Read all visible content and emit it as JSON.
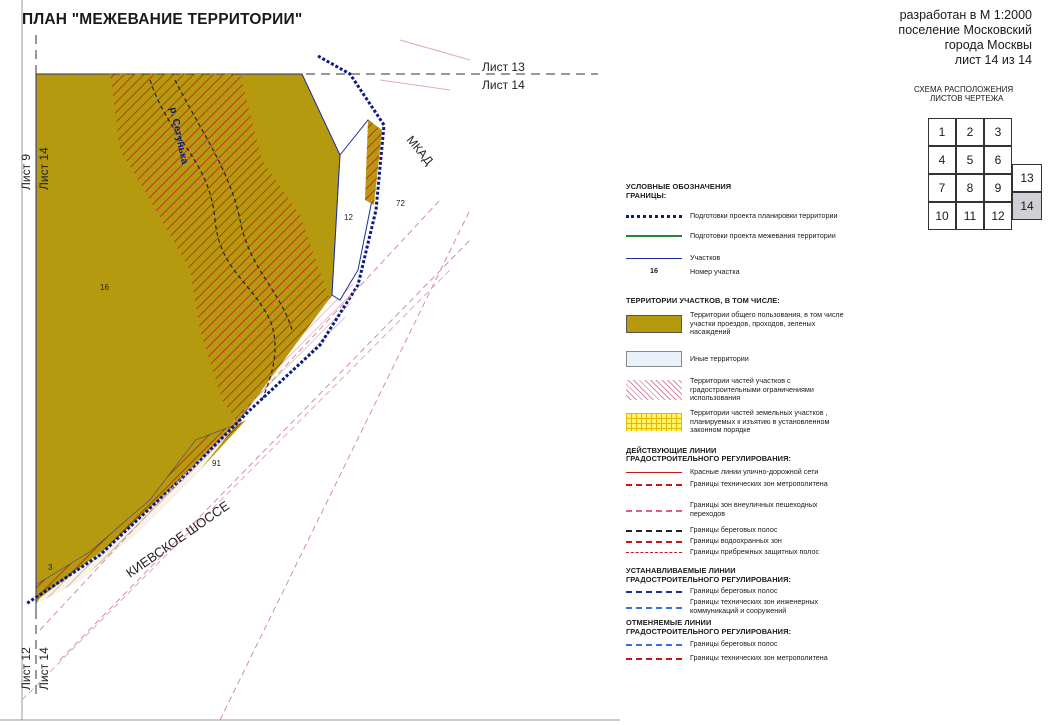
{
  "title": "ПЛАН \"МЕЖЕВАНИЕ ТЕРРИТОРИИ\"",
  "scale_block": {
    "line1": "разработан в М 1:2000",
    "line2": "поселение Московский",
    "line3": "города Москвы",
    "line4": "лист 14 из 14"
  },
  "scheme": {
    "title_line1": "СХЕМА РАСПОЛОЖЕНИЯ",
    "title_line2": "ЛИСТОВ ЧЕРТЕЖА",
    "cells": [
      "1",
      "2",
      "3",
      "4",
      "5",
      "6",
      "7",
      "8",
      "9",
      "10",
      "11",
      "12",
      "13",
      "14"
    ],
    "current": "14"
  },
  "map": {
    "sheet_top_a": "Лист 13",
    "sheet_top_b": "Лист 14",
    "sheet_left_a": "Лист 9",
    "sheet_left_b": "Лист 14",
    "sheet_bottom_a": "Лист 12",
    "sheet_bottom_b": "Лист 14",
    "river": "р. Сетунька",
    "mkad": "МКАД",
    "highway": "КИЕВСКОЕ ШОССЕ",
    "parcel_16": "16",
    "parcel_12": "12",
    "parcel_72": "72",
    "parcel_91": "91",
    "parcel_3": "3"
  },
  "legend": {
    "header": "УСЛОВНЫЕ ОБОЗНАЧЕНИЯ",
    "borders_header": "ГРАНИЦЫ:",
    "b1": "Подготовки проекта планировки территории",
    "b2": "Подготовки проекта межевания территории",
    "b3": "Участков",
    "b4_num": "16",
    "b4": "Номер участка",
    "terr_header": "ТЕРРИТОРИИ УЧАСТКОВ, В ТОМ ЧИСЛЕ:",
    "t1": "Территории общего пользования, в том числе участки проездов, проходов, зеленых насаждений",
    "t2": "Иные территории",
    "t3": "Территории частей участков с градостроительными ограничениями использования",
    "t4": "Территории частей земельных участков , планируемых к изъятию в установленном законном порядке",
    "active_header1": "ДЕЙСТВУЮЩИЕ ЛИНИИ",
    "active_header2": "ГРАДОСТРОИТЕЛЬНОГО РЕГУЛИРОВАНИЯ:",
    "a1": "Красные линии улично-дорожной сети",
    "a2": "Границы технических зон метрополитена",
    "a3": "Границы зон внеуличных пешеходных переходов",
    "a4": "Границы береговых полос",
    "a5": "Границы водоохранных зон",
    "a6": "Границы прибрежных защитных полос",
    "set_header1": "УСТАНАВЛИВАЕМЫЕ ЛИНИИ",
    "set_header2": "ГРАДОСТРОИТЕЛЬНОГО РЕГУЛИРОВАНИЯ:",
    "s1": "Границы береговых полос",
    "s2": "Границы технических зон инженерных коммуникаций и сооружений",
    "cancel_header1": "ОТМЕНЯЕМЫЕ ЛИНИИ",
    "cancel_header2": "ГРАДОСТРОИТЕЛЬНОГО РЕГУЛИРОВАНИЯ:",
    "c1": "Границы береговых полос",
    "c2": "Границы технических зон метрополитена"
  },
  "colors": {
    "olive": "#b59a10",
    "hatch": "#c41818",
    "project_border": "#0b1d80",
    "survey_border": "#2a8a2a",
    "parcel_border": "#1b2f9c",
    "pink": "#e6b3c4"
  }
}
